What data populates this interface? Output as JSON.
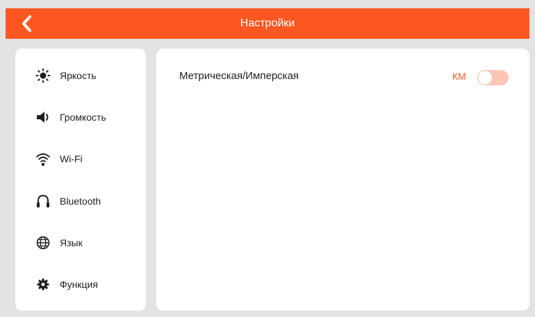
{
  "header": {
    "title": "Настройки",
    "accent_color": "#fe5722"
  },
  "sidebar": {
    "items": [
      {
        "label": "Яркость",
        "icon": "brightness-icon"
      },
      {
        "label": "Громкость",
        "icon": "speaker-icon"
      },
      {
        "label": "Wi-Fi",
        "icon": "wifi-icon"
      },
      {
        "label": "Bluetooth",
        "icon": "headphones-icon"
      },
      {
        "label": "Язык",
        "icon": "globe-icon"
      },
      {
        "label": "Функция",
        "icon": "gear-icon"
      }
    ]
  },
  "main": {
    "unit_setting": {
      "label": "Метрическая/Имперская",
      "value": "КМ",
      "toggle_on": false
    }
  }
}
